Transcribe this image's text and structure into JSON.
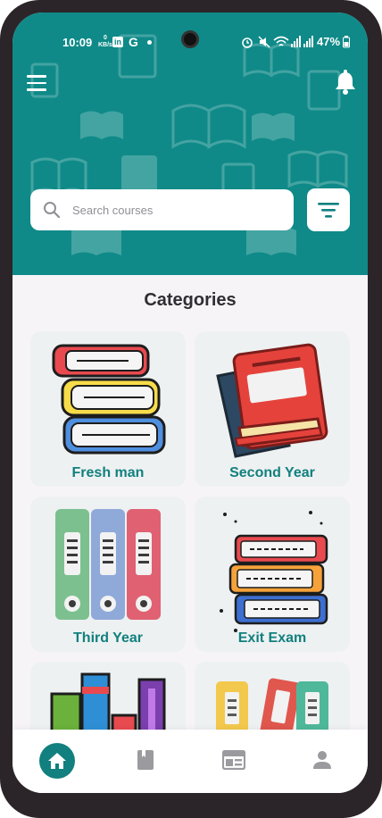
{
  "status_bar": {
    "time": "10:09",
    "net_speed_top": "0",
    "net_speed_unit": "KB/s",
    "g_label": "G",
    "linkedin_label": "in",
    "battery": "47%"
  },
  "header": {
    "search_placeholder": "Search courses"
  },
  "main": {
    "section_title": "Categories",
    "categories": [
      {
        "label": "Fresh man"
      },
      {
        "label": "Second Year"
      },
      {
        "label": "Third Year"
      },
      {
        "label": "Exit Exam"
      },
      {
        "label": ""
      },
      {
        "label": ""
      }
    ]
  },
  "bottom_nav": {
    "items": [
      {
        "icon": "home-icon",
        "active": true
      },
      {
        "icon": "book-icon",
        "active": false
      },
      {
        "icon": "news-icon",
        "active": false
      },
      {
        "icon": "person-icon",
        "active": false
      }
    ]
  },
  "colors": {
    "primary": "#11807e",
    "header_bg": "#0f8a88",
    "card_bg": "#eef1f2",
    "text_dark": "#2f2f33"
  }
}
